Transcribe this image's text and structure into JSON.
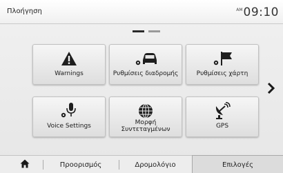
{
  "header": {
    "title": "Πλοήγηση",
    "ampm": "AM",
    "time": "09:10"
  },
  "pagination": {
    "total": 2,
    "current": 1
  },
  "tiles": [
    {
      "label": "Warnings",
      "icon": "warning-icon"
    },
    {
      "label": "Ρυθμίσεις διαδρομής",
      "icon": "route-settings-icon"
    },
    {
      "label": "Ρυθμίσεις χάρτη",
      "icon": "map-settings-icon"
    },
    {
      "label": "Voice Settings",
      "icon": "voice-settings-icon"
    },
    {
      "label": "Μορφή Συντεταγμένων",
      "icon": "globe-icon"
    },
    {
      "label": "GPS",
      "icon": "satellite-icon"
    }
  ],
  "next_icon": "chevron-right-icon",
  "tabbar": {
    "home_icon": "home-icon",
    "tabs": [
      "Προορισμός",
      "Δρομολόγιο",
      "Επιλογές"
    ],
    "active_tab": "Επιλογές"
  }
}
